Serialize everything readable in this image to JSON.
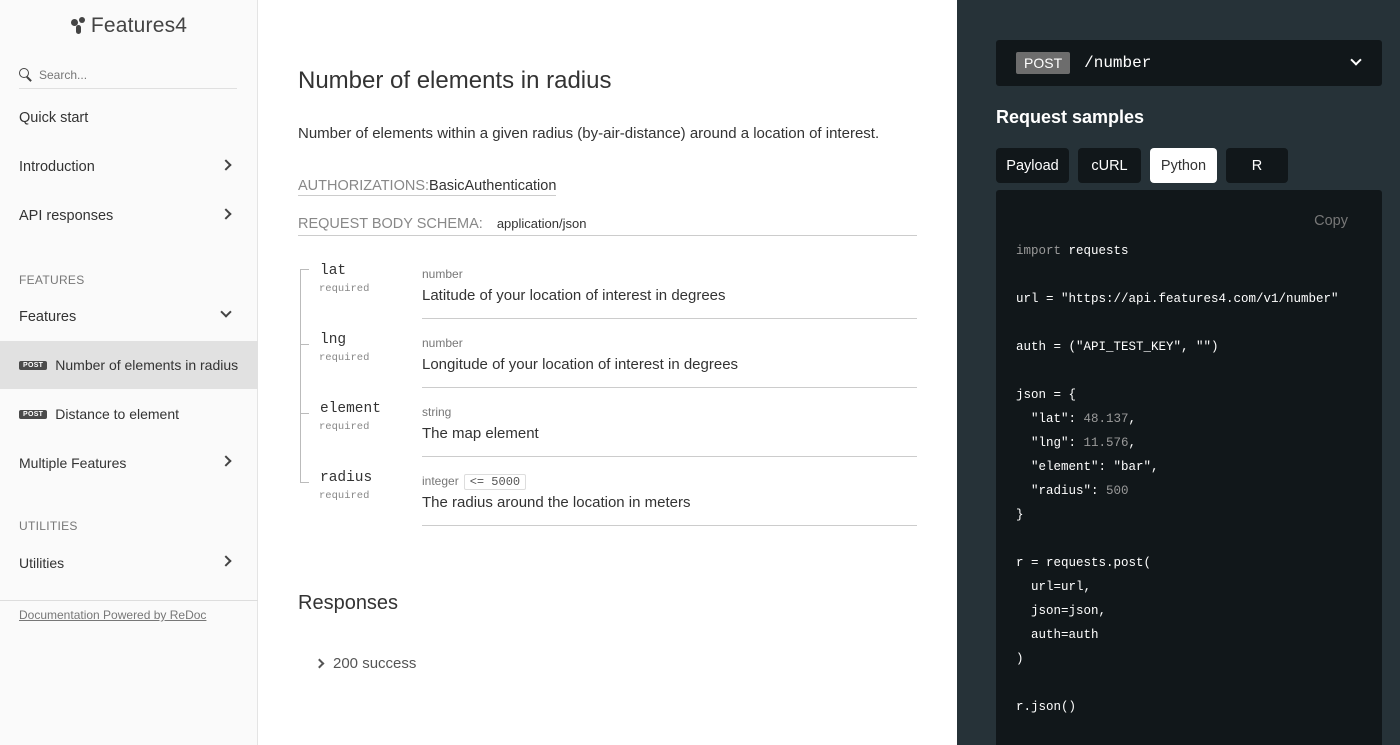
{
  "sidebar": {
    "logo": "Features4",
    "search_placeholder": "Search...",
    "items": {
      "quick_start": "Quick start",
      "introduction": "Introduction",
      "api_responses": "API responses",
      "features_section": "FEATURES",
      "features": "Features",
      "number_elements": "Number of elements in radius",
      "distance_element": "Distance to element",
      "multiple_features": "Multiple Features",
      "utilities_section": "UTILITIES",
      "utilities": "Utilities"
    },
    "post_badge": "POST",
    "footer_link": "Documentation Powered by ReDoc"
  },
  "main": {
    "title": "Number of elements in radius",
    "description": "Number of elements within a given radius (by-air-distance) around a location of interest.",
    "auth_label": "AUTHORIZATIONS:",
    "auth_value": "BasicAuthentication",
    "schema_label": "REQUEST BODY SCHEMA:",
    "schema_mime": "application/json",
    "params": [
      {
        "name": "lat",
        "required": "required",
        "type": "number",
        "constraint": "",
        "description": "Latitude of your location of interest in degrees"
      },
      {
        "name": "lng",
        "required": "required",
        "type": "number",
        "constraint": "",
        "description": "Longitude of your location of interest in degrees"
      },
      {
        "name": "element",
        "required": "required",
        "type": "string",
        "constraint": "",
        "description": "The map element"
      },
      {
        "name": "radius",
        "required": "required",
        "type": "integer",
        "constraint": "<= 5000",
        "description": "The radius around the location in meters"
      }
    ],
    "responses_title": "Responses",
    "response_200": "200 success"
  },
  "right": {
    "method": "POST",
    "path": "/number",
    "samples_title": "Request samples",
    "tabs": [
      "Payload",
      "cURL",
      "Python",
      "R"
    ],
    "active_tab": "Python",
    "copy": "Copy",
    "code": {
      "l1a": "import",
      "l1b": " requests",
      "l2": "url = \"https://api.features4.com/v1/number\"",
      "l3": "auth = (\"API_TEST_KEY\", \"\")",
      "l4": "json = {",
      "l5a": "  \"lat\": ",
      "l5b": "48.137",
      "l5c": ",",
      "l6a": "  \"lng\": ",
      "l6b": "11.576",
      "l6c": ",",
      "l7": "  \"element\": \"bar\",",
      "l8a": "  \"radius\": ",
      "l8b": "500",
      "l9": "}",
      "l10": "r = requests.post(",
      "l11": "  url=url,",
      "l12": "  json=json,",
      "l13": "  auth=auth",
      "l14": ")",
      "l15": "r.json()"
    }
  }
}
